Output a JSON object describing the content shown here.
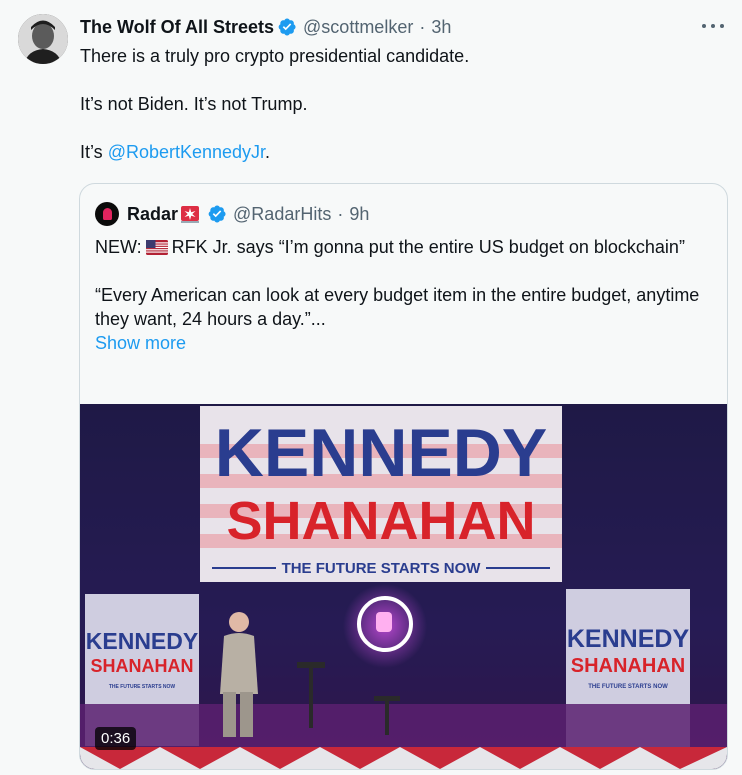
{
  "tweet": {
    "author_name": "The Wolf Of All Streets",
    "handle": "@scottmelker",
    "separator": "·",
    "time": "3h",
    "lines": [
      "There is a truly pro crypto presidential candidate.",
      "It’s not Biden. It’s not Trump."
    ],
    "line3_prefix": "It’s ",
    "mention": "@RobertKennedyJr",
    "line3_suffix": "."
  },
  "quote": {
    "author_name": "Radar",
    "handle": "@RadarHits",
    "separator": "·",
    "time": "9h",
    "para1_prefix": "NEW:",
    "para1_text": "RFK Jr. says “I’m gonna put the entire US budget on blockchain”",
    "para2_text": "“Every American can look at every budget item in the entire budget, anytime they want, 24 hours a day.”...",
    "show_more": "Show more"
  },
  "video": {
    "duration": "0:36",
    "banner_line1": "KENNEDY",
    "banner_line2": "SHANAHAN",
    "banner_tagline": "THE FUTURE STARTS NOW",
    "side_line1": "KENNEDY",
    "side_line2": "SHANAHAN",
    "side_tagline": "THE FUTURE STARTS NOW"
  },
  "colors": {
    "link": "#1d9bf0",
    "verified": "#1d9bf0",
    "secondary_text": "#536471",
    "banner_blue": "#2a3d8f",
    "banner_red": "#d8232a"
  },
  "icons": {
    "verified": "verified-badge-icon",
    "more": "more-options-icon",
    "siren": "siren-emoji-icon",
    "flag": "us-flag-emoji-icon"
  }
}
